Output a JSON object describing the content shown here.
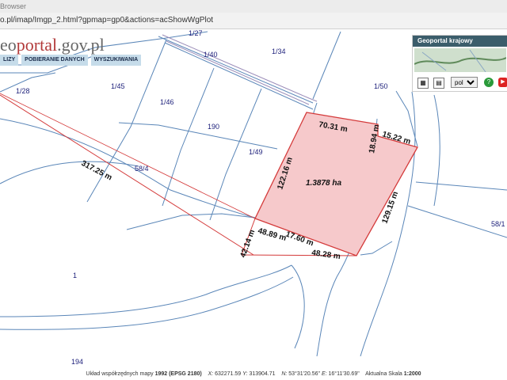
{
  "browser": {
    "title": "Browser",
    "url": "o.pl/imap/Imgp_2.html?gpmap=gp0&actions=acShowWgPlot"
  },
  "logo": {
    "prefix": "eo",
    "accent": "portal",
    "suffix": ".gov.pl"
  },
  "menu": [
    "LIZY",
    "POBIERANIE DANYCH",
    "WYSZUKIWANIA"
  ],
  "widget": {
    "title": "Geoportal krajowy",
    "language": "pol",
    "language_options": [
      "pol"
    ]
  },
  "map": {
    "parcels": [
      "1/27",
      "1/40",
      "1/34",
      "1/28",
      "1/45",
      "1/46",
      "190",
      "1/49",
      "1/50",
      "58/4",
      "58/1",
      "1",
      "194"
    ],
    "dimensions": [
      "317.25 m",
      "70.31 m",
      "18.94 m",
      "15.22 m",
      "122.16 m",
      "129.15 m",
      "42.14 m",
      "48.89 m",
      "17.60 m",
      "48.28 m"
    ],
    "area": "1.3878 ha",
    "colors": {
      "plot_fill": "#f6c9cb",
      "plot_stroke": "#d43a3a",
      "parcel_line": "#5a86b8",
      "road_line": "#9a8cb8",
      "label": "#1c1f7a"
    }
  },
  "status": {
    "system_label": "Układ współrzędnych mapy",
    "system_value": "1992 (EPSG 2180)",
    "x_label": "X:",
    "x_value": "632271.59",
    "y_label": "Y:",
    "y_value": "313904.71",
    "n_label": "N:",
    "n_value": "53°31'20.56\"",
    "e_label": "E:",
    "e_value": "16°11'30.69\"",
    "scale_label": "Aktualna Skala",
    "scale_value": "1:2000"
  }
}
